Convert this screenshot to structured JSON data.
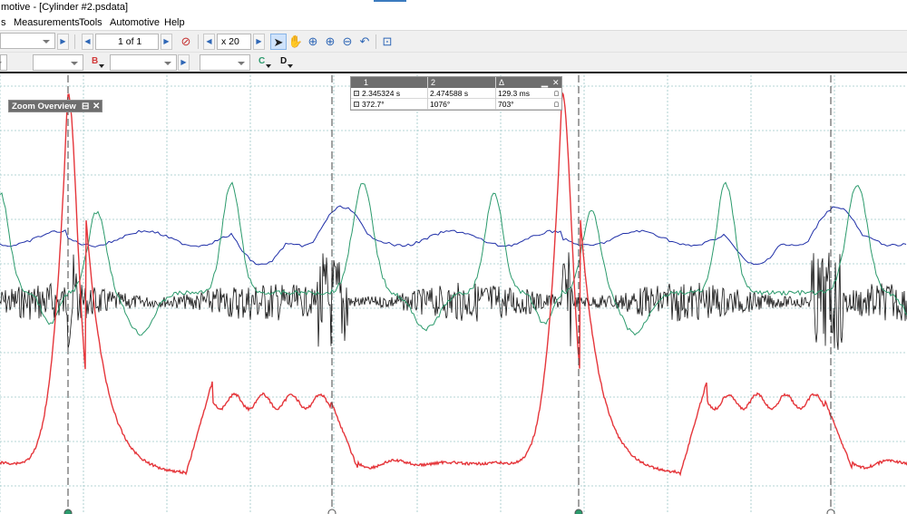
{
  "window": {
    "title": "motive - [Cylinder #2.psdata]"
  },
  "menu": {
    "items": [
      {
        "label": "s"
      },
      {
        "label": "Measurements"
      },
      {
        "label": "Tools"
      },
      {
        "label": "Automotive"
      },
      {
        "label": "Help"
      }
    ]
  },
  "toolbar": {
    "page_indicator": "1 of 1",
    "zoom_value": "x 20",
    "channel_buttons": [
      "B",
      "C",
      "D"
    ]
  },
  "zoom_overview": {
    "title": "Zoom Overview"
  },
  "rulers": {
    "headers": [
      "1",
      "2",
      "Δ"
    ],
    "rows": [
      {
        "c1": "2.345324 s",
        "c2": "2.474588 s",
        "delta": "129.3 ms"
      },
      {
        "c1": "372.7°",
        "c2": "1076°",
        "delta": "703°"
      }
    ]
  },
  "colors": {
    "ch_a_red": "#e5363b",
    "ch_b_blue": "#1f2fa8",
    "ch_c_green": "#2b9a6c",
    "ch_d_black": "#111111",
    "grid": "#9cc7c7",
    "ruler": "#444444",
    "accent": "#3b7bbf"
  },
  "icons": {
    "toolbar": [
      "compass-icon",
      "pointer-icon",
      "hand-icon",
      "zoom-in-icon",
      "zoom-out-icon",
      "zoom-fit-icon",
      "undo-zoom-icon",
      "zoom-overview-icon"
    ]
  }
}
